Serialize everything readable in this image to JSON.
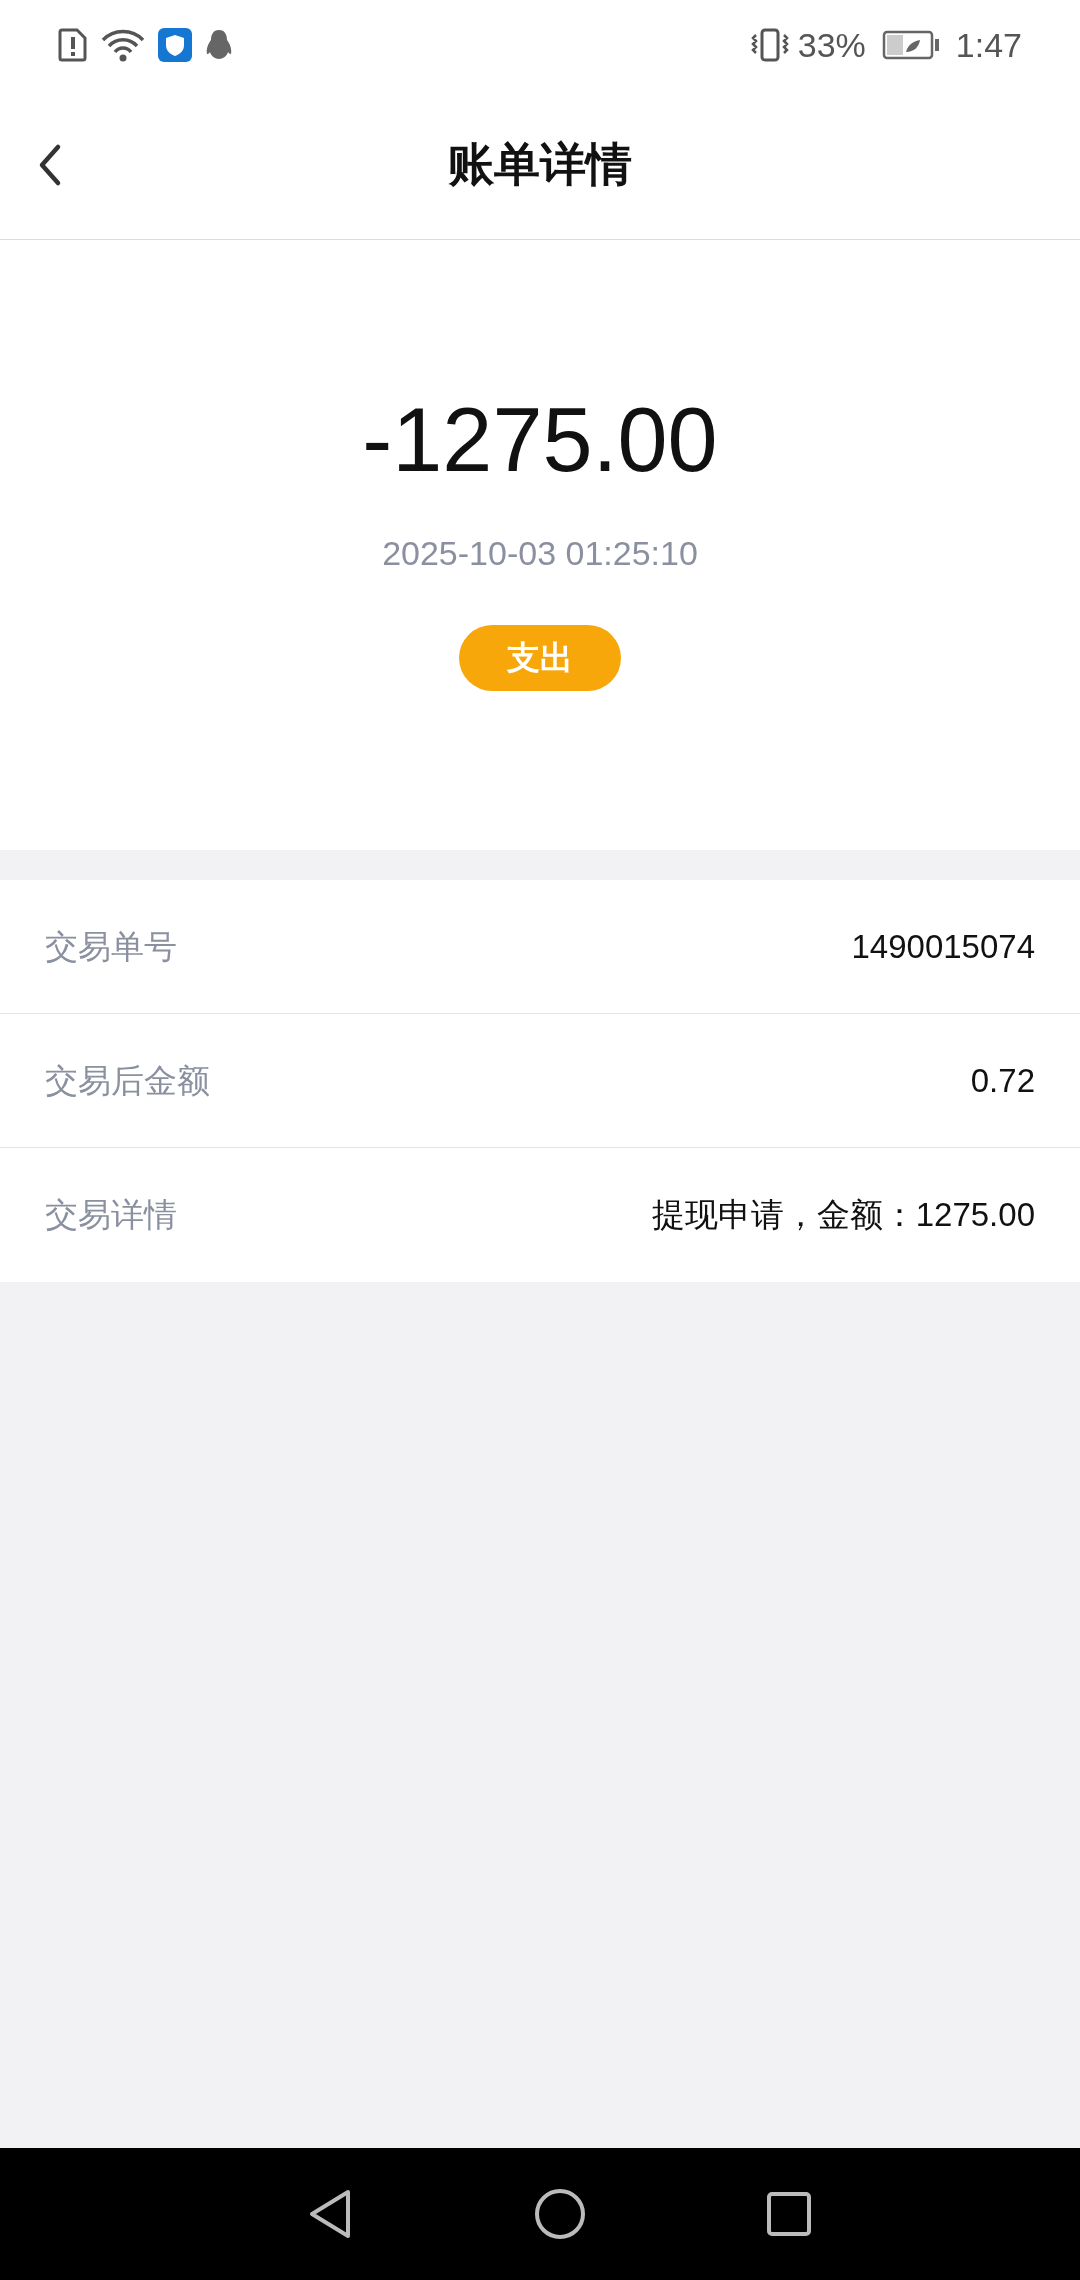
{
  "status_bar": {
    "battery": "33%",
    "time": "1:47"
  },
  "header": {
    "title": "账单详情"
  },
  "summary": {
    "amount": "-1275.00",
    "datetime": "2025-10-03 01:25:10",
    "tag": "支出"
  },
  "details": [
    {
      "label": "交易单号",
      "value": "1490015074"
    },
    {
      "label": "交易后金额",
      "value": "0.72"
    },
    {
      "label": "交易详情",
      "value": "提现申请，金额：1275.00"
    }
  ]
}
